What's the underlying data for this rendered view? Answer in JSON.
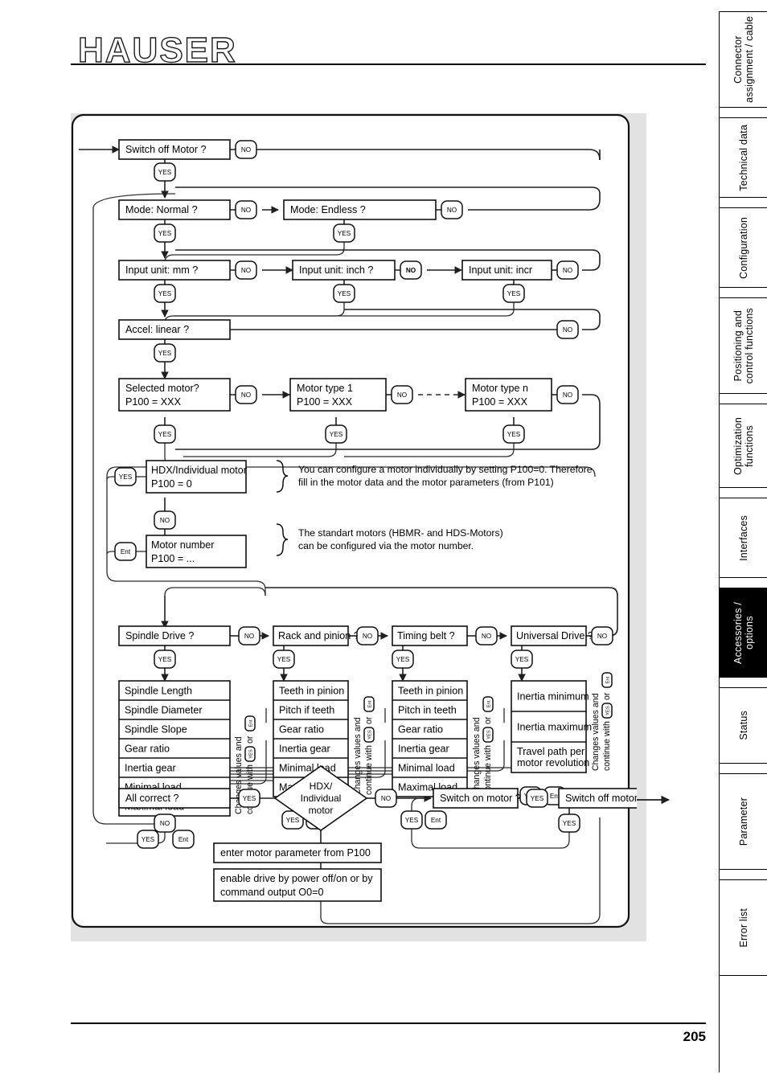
{
  "header": {
    "logo": "HAUSER"
  },
  "footer": {
    "page_number": "205"
  },
  "sidebar": {
    "tabs": [
      {
        "label": "Connector\nassignment / cable",
        "active": false
      },
      {
        "label": "Technical data",
        "active": false
      },
      {
        "label": "Configuration",
        "active": false
      },
      {
        "label": "Positioning and\ncontrol functions",
        "active": false
      },
      {
        "label": "Optimization\nfunctions",
        "active": false
      },
      {
        "label": "Interfaces",
        "active": false
      },
      {
        "label": "Accessories /\noptions",
        "active": true
      },
      {
        "label": "Status",
        "active": false
      },
      {
        "label": "Parameter",
        "active": false
      },
      {
        "label": "Error list",
        "active": false
      }
    ]
  },
  "flowchart": {
    "nodes": {
      "switch_off_motor": "Switch off Motor ?",
      "mode_normal": "Mode: Normal ?",
      "mode_endless": "Mode: Endless ?",
      "input_mm": "Input unit:  mm ?",
      "input_inch": "Input unit:  inch ?",
      "input_incr": "Input unit: incr",
      "accel_linear": "Accel:  linear ?",
      "selected_motor_l1": "Selected motor?",
      "selected_motor_l2": "P100 = XXX",
      "motor_type_1_l1": "Motor type 1",
      "motor_type_1_l2": "P100 = XXX",
      "motor_type_n_l1": "Motor type n",
      "motor_type_n_l2": "P100 = XXX",
      "hdx_individual_l1": "HDX/Individual motor",
      "hdx_individual_l2": "P100 = 0",
      "motor_number_l1": "Motor number",
      "motor_number_l2": "P100 = ...",
      "spindle_drive": "Spindle Drive ?",
      "rack_and_pinion": "Rack and pinion ?",
      "timing_belt": "Timing belt ?",
      "universal_drive": "Universal Drive ?",
      "all_correct": "All correct ?",
      "diamond_l1": "HDX/",
      "diamond_l2": "Individual",
      "diamond_l3": "motor",
      "switch_on_motor": "Switch on motor ?",
      "switch_off_motor_2": "Switch off motor ?",
      "enter_motor_parameter": "enter motor parameter from P100",
      "enable_drive_l1": "enable drive by power off/on or by",
      "enable_drive_l2": "command output O0=0"
    },
    "badges": {
      "yes": "YES",
      "no": "NO",
      "ent": "Ent"
    },
    "notes": [
      {
        "line1": "You can configure a motor individually by setting P100=0. Therefore",
        "line2": "fill in the motor data and the motor parameters (from P101)"
      },
      {
        "line1": "The standart motors (HBMR- and HDS-Motors)",
        "line2": "can be configured via the motor number."
      }
    ],
    "param_columns": [
      {
        "name": "spindle-drive-parameters",
        "items": [
          "Spindle Length",
          "Spindle Diameter",
          "Spindle Slope",
          "Gear ratio",
          "Inertia gear",
          "Minimal load",
          "Maximal load"
        ]
      },
      {
        "name": "rack-and-pinion-parameters",
        "items": [
          "Teeth in pinion",
          "Pitch if teeth",
          "Gear ratio",
          "Inertia gear",
          "Minimal load",
          "Maximal load"
        ]
      },
      {
        "name": "timing-belt-parameters",
        "items": [
          "Teeth in pinion",
          "Pitch in teeth",
          "Gear ratio",
          "Inertia gear",
          "Minimal load",
          "Maximal load"
        ]
      },
      {
        "name": "universal-drive-parameters",
        "items": [
          "Inertia minimum",
          "Inertia maximum",
          "Travel path per\nmotor revolution"
        ]
      }
    ],
    "side_label": {
      "line1": "Changes values and",
      "line2a": "continue with",
      "line2b": "or"
    }
  }
}
